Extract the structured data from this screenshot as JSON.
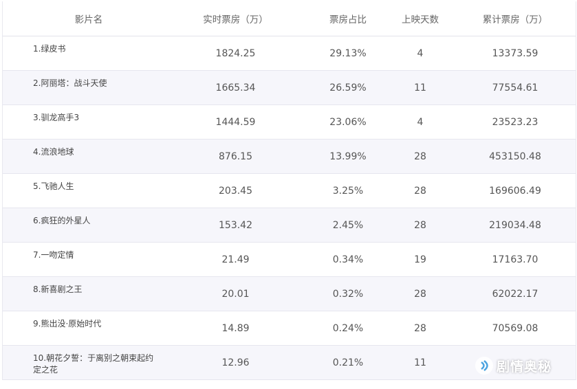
{
  "table": {
    "headers": {
      "name": "影片名",
      "realtime": "实时票房（万）",
      "share": "票房占比",
      "days": "上映天数",
      "total": "累计票房（万）"
    },
    "rows": [
      {
        "name": "1.绿皮书",
        "realtime": "1824.25",
        "share": "29.13%",
        "days": "4",
        "total": "13373.59"
      },
      {
        "name": "2.阿丽塔：战斗天使",
        "realtime": "1665.34",
        "share": "26.59%",
        "days": "11",
        "total": "77554.61"
      },
      {
        "name": "3.驯龙高手3",
        "realtime": "1444.59",
        "share": "23.06%",
        "days": "4",
        "total": "23523.23"
      },
      {
        "name": "4.流浪地球",
        "realtime": "876.15",
        "share": "13.99%",
        "days": "28",
        "total": "453150.48"
      },
      {
        "name": "5.飞驰人生",
        "realtime": "203.45",
        "share": "3.25%",
        "days": "28",
        "total": "169606.49"
      },
      {
        "name": "6.疯狂的外星人",
        "realtime": "153.42",
        "share": "2.45%",
        "days": "28",
        "total": "219034.48"
      },
      {
        "name": "7.一吻定情",
        "realtime": "21.49",
        "share": "0.34%",
        "days": "19",
        "total": "17163.70"
      },
      {
        "name": "8.新喜剧之王",
        "realtime": "20.01",
        "share": "0.32%",
        "days": "28",
        "total": "62022.17"
      },
      {
        "name": "9.熊出没·原始时代",
        "realtime": "14.89",
        "share": "0.24%",
        "days": "28",
        "total": "70569.08"
      },
      {
        "name": "10.朝花夕誓：于离别之朝束起约定之花",
        "realtime": "12.96",
        "share": "0.21%",
        "days": "11",
        "total": ""
      }
    ]
  },
  "watermark": {
    "text": "剧情奥秘",
    "icon": "sound-logo-icon"
  }
}
